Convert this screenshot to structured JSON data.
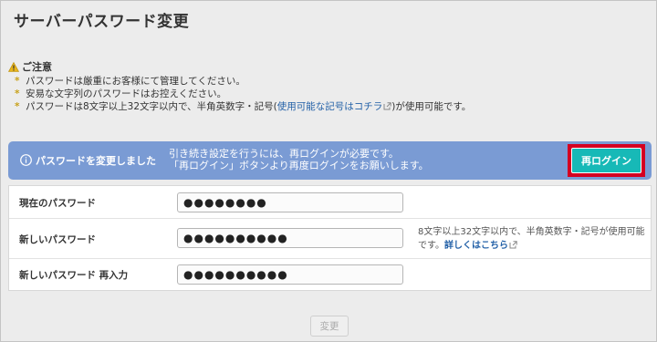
{
  "page": {
    "title": "サーバーパスワード変更"
  },
  "notice": {
    "heading": "ご注意",
    "items": [
      "パスワードは厳重にお客様にて管理してください。",
      "安易な文字列のパスワードはお控えください。"
    ],
    "item3_before": "パスワードは8文字以上32文字以内で、半角英数字・記号(",
    "item3_link": "使用可能な記号はコチラ",
    "item3_after": ")が使用可能です。"
  },
  "banner": {
    "title": "パスワードを変更しました",
    "line1": "引き続き設定を行うには、再ログインが必要です。",
    "line2": "「再ログイン」ボタンより再度ログインをお願いします。",
    "button_label": "再ログイン"
  },
  "form": {
    "current": {
      "label": "現在のパスワード",
      "value": "●●●●●●●●"
    },
    "new": {
      "label": "新しいパスワード",
      "value": "●●●●●●●●●●"
    },
    "confirm": {
      "label": "新しいパスワード 再入力",
      "value": "●●●●●●●●●●"
    },
    "hint_text": "8文字以上32文字以内で、半角英数字・記号が使用可能です。",
    "hint_link": "詳しくはこちら"
  },
  "submit": {
    "label": "変更"
  },
  "colors": {
    "banner_bg": "#7a9bd4",
    "relogin_button": "#17b9b7",
    "highlight_frame": "#d40021",
    "link": "#2562a8",
    "warning": "#e8b51c"
  },
  "icons": {
    "warning": "warning-triangle-icon",
    "info": "info-circle-icon",
    "external": "external-link-icon"
  }
}
